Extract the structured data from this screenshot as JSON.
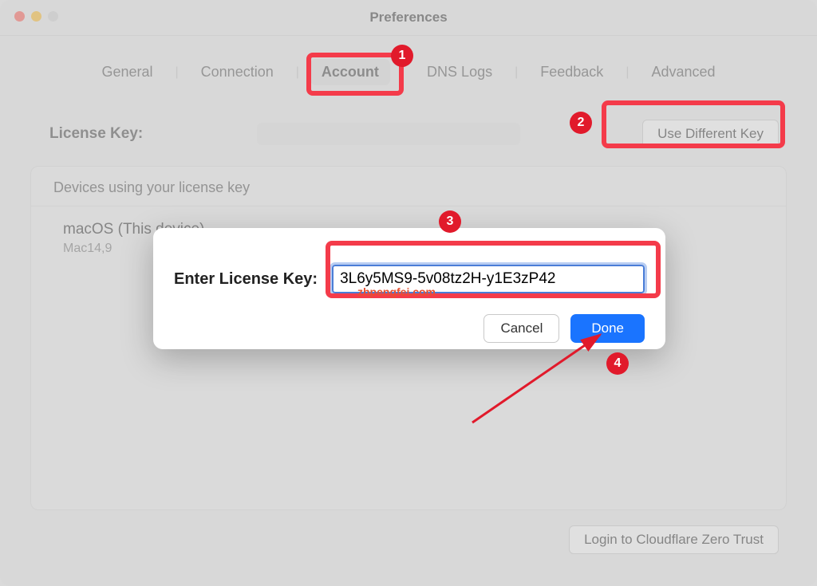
{
  "window": {
    "title": "Preferences"
  },
  "tabs": {
    "items": [
      "General",
      "Connection",
      "Account",
      "DNS Logs",
      "Feedback",
      "Advanced"
    ],
    "active_index": 2
  },
  "account": {
    "license_key_label": "License Key:",
    "use_different_key_button": "Use Different Key",
    "devices_header": "Devices using your license key",
    "devices": [
      {
        "name": "macOS (This device)",
        "sub": "Mac14,9"
      }
    ],
    "login_button": "Login to Cloudflare Zero Trust"
  },
  "modal": {
    "label": "Enter License Key:",
    "value": "3L6y5MS9-5v08tz2H-y1E3zP42",
    "cancel": "Cancel",
    "done": "Done"
  },
  "annotations": {
    "callouts": [
      "1",
      "2",
      "3",
      "4"
    ],
    "watermark": "zhpengfei.com"
  }
}
